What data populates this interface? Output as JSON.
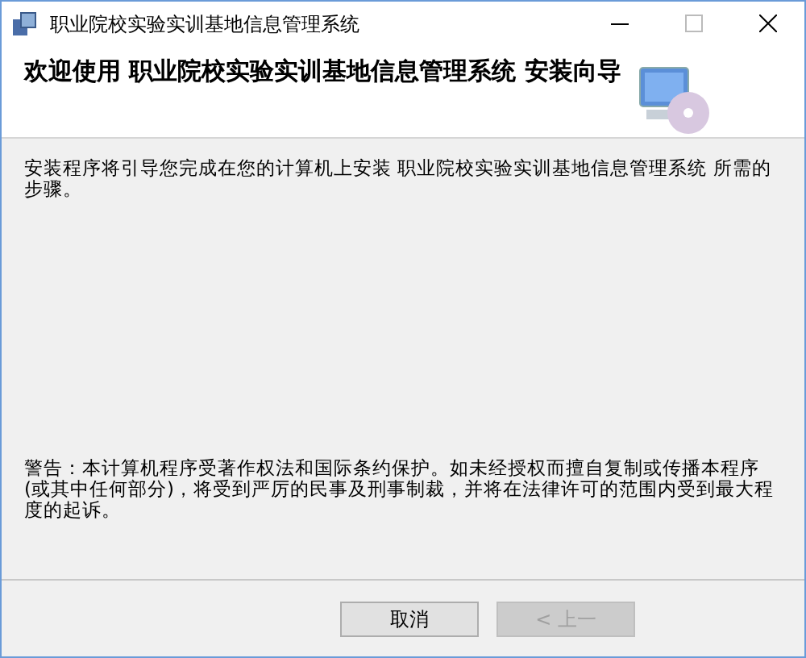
{
  "window": {
    "title": "职业院校实验实训基地信息管理系统"
  },
  "header": {
    "title": "欢迎使用 职业院校实验实训基地信息管理系统 安装向导"
  },
  "body": {
    "intro": "安装程序将引导您完成在您的计算机上安装 职业院校实验实训基地信息管理系统 所需的步骤。",
    "warning": "警告：本计算机程序受著作权法和国际条约保护。如未经授权而擅自复制或传播本程序(或其中任何部分)，将受到严厉的民事及刑事制裁，并将在法律许可的范围内受到最大程度的起诉。"
  },
  "buttons": [
    {
      "label": "取消",
      "disabled": false
    },
    {
      "label": "< 上一",
      "disabled": true
    }
  ]
}
